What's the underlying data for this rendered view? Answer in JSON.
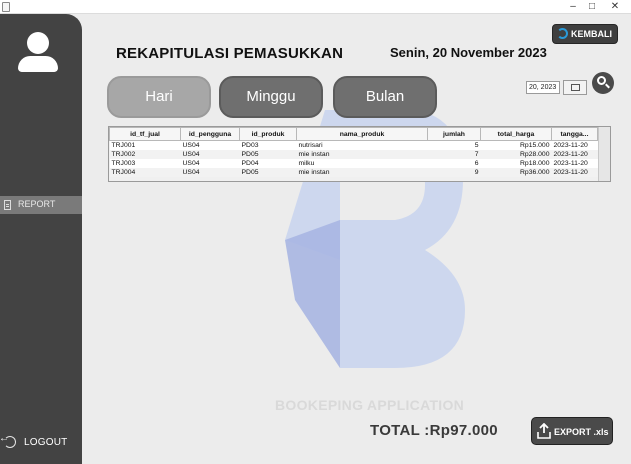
{
  "window": {
    "min_glyph": "–",
    "max_glyph": "□",
    "close_glyph": "✕"
  },
  "sidebar": {
    "report_label": "REPORT",
    "logout_label": "LOGOUT"
  },
  "header": {
    "title": "REKAPITULASI PEMASUKKAN",
    "date": "Senin, 20 November 2023",
    "back_label": "KEMBALI"
  },
  "period_tabs": [
    "Hari",
    "Minggu",
    "Bulan"
  ],
  "filter": {
    "date_value": "20, 2023"
  },
  "table": {
    "columns": [
      "id_tf_jual",
      "id_pengguna",
      "id_produk",
      "nama_produk",
      "jumlah",
      "total_harga",
      "tangga..."
    ],
    "rows": [
      [
        "TRJ001",
        "US04",
        "PD03",
        "nutrisari",
        "5",
        "Rp15.000",
        "2023-11-20"
      ],
      [
        "TRJ002",
        "US04",
        "PD05",
        "mie instan",
        "7",
        "Rp28.000",
        "2023-11-20"
      ],
      [
        "TRJ003",
        "US04",
        "PD04",
        "milku",
        "6",
        "Rp18.000",
        "2023-11-20"
      ],
      [
        "TRJ004",
        "US04",
        "PD05",
        "mie instan",
        "9",
        "Rp36.000",
        "2023-11-20"
      ]
    ]
  },
  "watermark_text": "BOOKEPING APPLICATION",
  "footer": {
    "total": "TOTAL :Rp97.000",
    "export_label": "EXPORT .xls"
  },
  "colors": {
    "sidebar": "#434343",
    "accent_blue": "#2a9ad8",
    "watermark_blue": "#b9c8ea"
  }
}
